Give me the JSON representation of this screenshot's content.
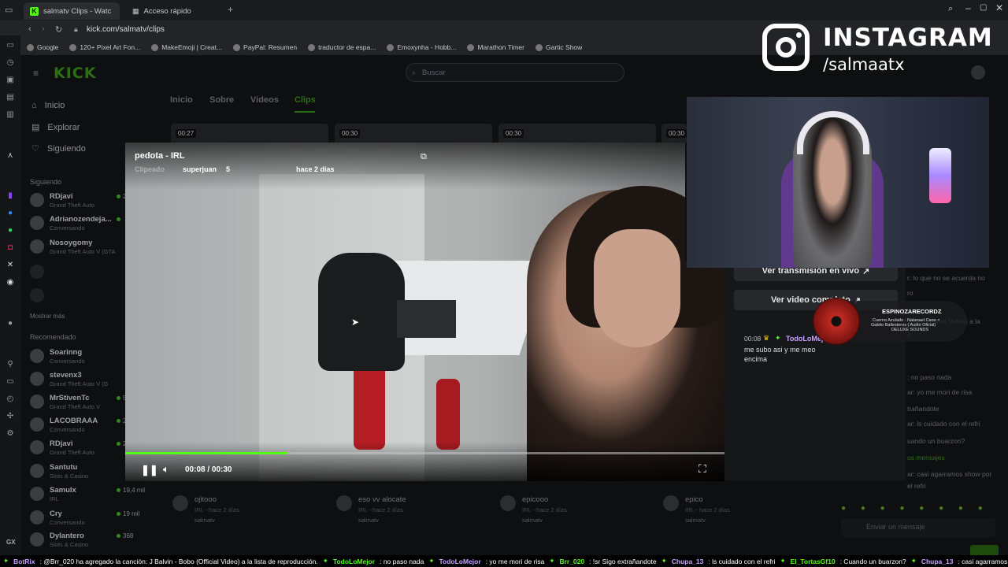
{
  "browser": {
    "tabs": [
      {
        "label": "salmatv Clips - Watch",
        "active": true
      },
      {
        "label": "Acceso rápido",
        "active": false
      }
    ],
    "url": "kick.com/salmatv/clips",
    "bookmarks": [
      "Google",
      "120+ Pixel Art Fon...",
      "MakeEmoji | Creat...",
      "PayPal: Resumen",
      "traductor de espa...",
      "Emoxynha - Hobb...",
      "Marathon Timer",
      "Gartic Show"
    ]
  },
  "kick": {
    "logo": "KICK",
    "search_placeholder": "Buscar",
    "nav": [
      "Inicio",
      "Explorar",
      "Siguiendo"
    ],
    "following_title": "Siguiendo",
    "following": [
      {
        "name": "RDjavi",
        "sub": "Grand Theft Auto",
        "viewers": "2"
      },
      {
        "name": "Adrianozendeja...",
        "sub": "Conversando",
        "viewers": ""
      },
      {
        "name": "Nosoygomy",
        "sub": "Grand Theft Auto V (GTA",
        "viewers": ""
      }
    ],
    "show_more": "Mostrar más",
    "recommended_title": "Recomendado",
    "recommended": [
      {
        "name": "Soarinng",
        "sub": "Conversando",
        "viewers": ""
      },
      {
        "name": "stevenx3",
        "sub": "Grand Theft Auto V (G",
        "viewers": ""
      },
      {
        "name": "MrStivenTc",
        "sub": "Grand Theft Auto V",
        "viewers": "5"
      },
      {
        "name": "LACOBRAAA",
        "sub": "Conversando",
        "viewers": "2"
      },
      {
        "name": "RDjavi",
        "sub": "Grand Theft Auto",
        "viewers": "2"
      },
      {
        "name": "Santutu",
        "sub": "Slots & Casino",
        "viewers": ""
      },
      {
        "name": "Samulx",
        "sub": "IRL",
        "viewers": "19,4 mil"
      },
      {
        "name": "Cry",
        "sub": "Conversando",
        "viewers": "19 mil"
      },
      {
        "name": "Dylantero",
        "sub": "Slots & Casino",
        "viewers": "368"
      }
    ],
    "profile_tabs": [
      "Inicio",
      "Sobre",
      "Videos",
      "Clips"
    ],
    "thumb_durations": [
      "00:27",
      "00:30",
      "00:30",
      "00:30"
    ],
    "cards": [
      {
        "title": "ojitooo",
        "meta": "IRL - hace 2 días",
        "user": "salmatv"
      },
      {
        "title": "eso vv alocate",
        "meta": "IRL - hace 2 días",
        "user": "salmatv"
      },
      {
        "title": "epicooo",
        "meta": "IRL - hace 2 días",
        "user": "salmatv"
      },
      {
        "title": "epico",
        "meta": "IRL - hace 2 días",
        "user": "salmatv"
      }
    ],
    "gx_label": "GX"
  },
  "clip": {
    "title": "pedota - IRL",
    "clipped_by_label": "Clipeado",
    "clipped_by": "superjuan",
    "views": "5",
    "age": "hace 2 días",
    "time": "00:08 / 00:30",
    "progress": 0.27
  },
  "panel": {
    "live_button": "Ver transmisión en vivo",
    "video_button": "Ver video completo",
    "chat_time": "00:08",
    "chat_user": "TodoLoMejor",
    "chat_msg": "me subo asi y me meo encima"
  },
  "right_chat": [
    "r: lo que no se acuerda no",
    "ro",
    "bobo (Official Video) a la",
    "n.",
    ": no paso nada",
    "ar: yo me mori de risa",
    "trañandote",
    "ar: ls cuidado con el refri",
    "uando un buarzon?",
    "os mensajes",
    "ar: casi agarramos show por",
    "el refri"
  ],
  "chat_input_placeholder": "Enviar un mensaje",
  "instagram": {
    "title": "INSTAGRAM",
    "handle": "/salmaatx"
  },
  "music": {
    "artist": "ESPINOZARECORDZ",
    "line1": "Cuerno Azulado - Natanael Cano ×",
    "line2": "Gabito Ballesteros ( Audio Oficial)",
    "line3": "DELUXE SOUNDS"
  },
  "ticker": [
    {
      "user": "BotRix",
      "msg": ": @Brr_020 ha agregado la canción: J Balvin - Bobo (Official Video) a la lista de reproducción."
    },
    {
      "user": "TodoLoMejor",
      "msg": ": no paso nada"
    },
    {
      "user": "TodoLoMejor",
      "msg": ": yo me mori de risa"
    },
    {
      "user": "Brr_020",
      "msg": ": !sr Sigo extrañandote"
    },
    {
      "user": "Chupa_13",
      "msg": ": ls cuidado con el refri"
    },
    {
      "user": "El_TortasGf10",
      "msg": ": Cuando un buarzon?"
    },
    {
      "user": "Chupa_13",
      "msg": ": casi agarramos show por el refri"
    }
  ]
}
